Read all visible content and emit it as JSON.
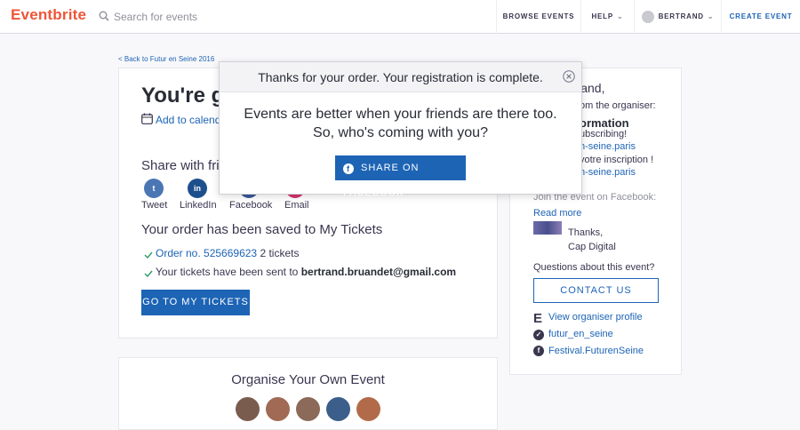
{
  "header": {
    "logo": "Eventbrite",
    "search_placeholder": "Search for events",
    "browse_events": "BROWSE EVENTS",
    "help": "HELP",
    "user": "BERTRAND",
    "create_event": "CREATE EVENT"
  },
  "back_link": "< Back to Futur en Seine 2016",
  "main": {
    "headline": "You're go",
    "add_calendar": "Add to calenda",
    "share_title": "Share with frie",
    "social": [
      {
        "glyph": "t",
        "label": "Tweet"
      },
      {
        "glyph": "in",
        "label": "LinkedIn"
      },
      {
        "glyph": "f",
        "label": "Facebook"
      },
      {
        "glyph": "@",
        "label": "Email"
      }
    ],
    "saved_title": "Your order has been saved to My Tickets",
    "order_prefix": "Order no. 525669623",
    "order_suffix": "2 tickets",
    "sent_prefix": "Your tickets have been sent to",
    "sent_email": "bertrand.bruandet@gmail.com",
    "go_tickets": "GO TO MY TICKETS"
  },
  "organise": {
    "title": "Organise Your Own Event",
    "avatar_colors": [
      "#7a5c4e",
      "#a06a55",
      "#8b6a5a",
      "#3b5f8a",
      "#b26b4a"
    ]
  },
  "sidebar": {
    "greeting": "rtrand,",
    "from_organiser": "om the organiser:",
    "info_title": "ormation",
    "subscribing": "ubscribing!",
    "link1": "n-seine.paris",
    "votre": "votre inscription !",
    "link2": "n-seine.paris",
    "facebook_note": "Join the event on Facebook:",
    "read_more": "Read more",
    "thanks": "Thanks,",
    "signature": "Cap Digital",
    "questions": "Questions about this event?",
    "contact": "CONTACT US",
    "view_profile": "View organiser profile",
    "twitter": "futur_en_seine",
    "facebook": "Festival.FuturenSeine"
  },
  "modal": {
    "title": "Thanks for your order. Your registration is complete.",
    "body": "Events are better when your friends are there too. So, who's coming with you?",
    "share_button": "SHARE ON FACEBOOK"
  },
  "colors": {
    "brand": "#f05537",
    "primary": "#1d64b5"
  }
}
